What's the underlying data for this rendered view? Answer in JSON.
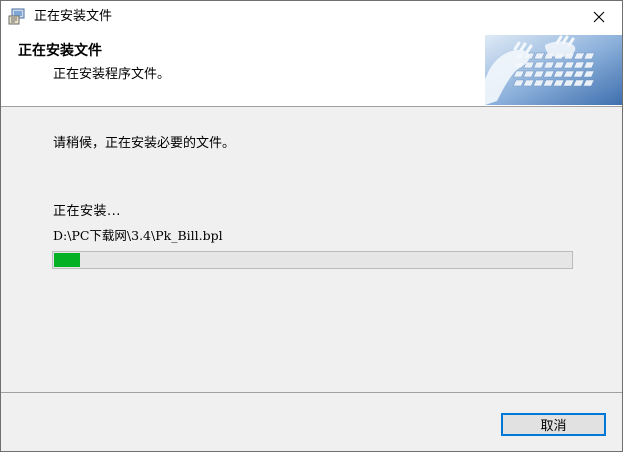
{
  "window": {
    "title": "正在安装文件"
  },
  "icons": {
    "app": "installer-icon",
    "close": "close-icon"
  },
  "header": {
    "title": "正在安装文件",
    "subtitle": "正在安装程序文件。",
    "image": "keyboard-hands-image"
  },
  "body": {
    "message": "请稍候，正在安装必要的文件。",
    "status_label": "正在安装...",
    "current_file": "D:\\PC下载网\\3.4\\Pk_Bill.bpl",
    "progress": 0.05
  },
  "footer": {
    "cancel_label": "取消"
  },
  "colors": {
    "progress": "#06b025",
    "accent": "#0078d7"
  }
}
